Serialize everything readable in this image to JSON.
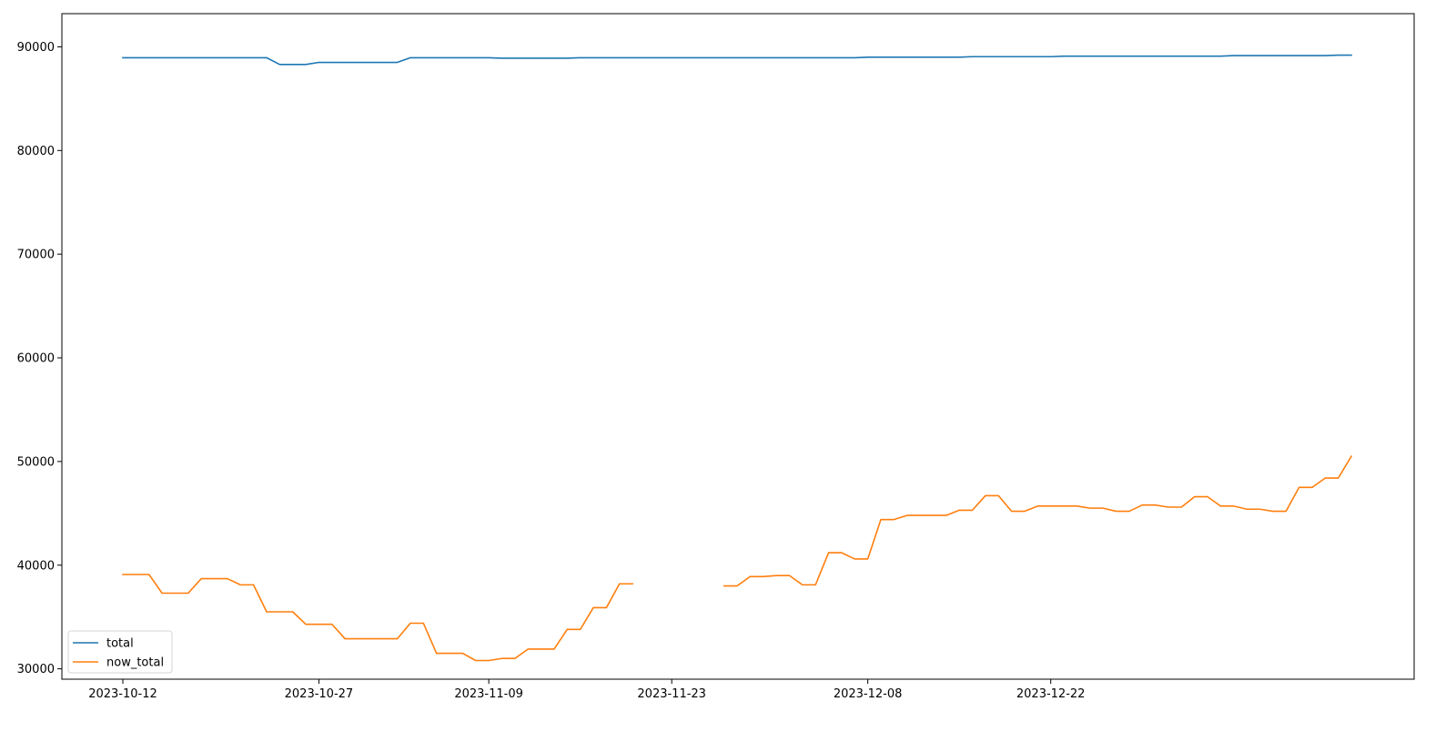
{
  "chart_data": {
    "type": "line",
    "title": "",
    "xlabel": "",
    "ylabel": "",
    "x_start": "2023-10-12",
    "dates": [
      "2023-10-12",
      "2023-10-13",
      "2023-10-14",
      "2023-10-15",
      "2023-10-16",
      "2023-10-17",
      "2023-10-18",
      "2023-10-19",
      "2023-10-20",
      "2023-10-21",
      "2023-10-22",
      "2023-10-23",
      "2023-10-24",
      "2023-10-25",
      "2023-10-26",
      "2023-10-27",
      "2023-10-28",
      "2023-10-29",
      "2023-10-30",
      "2023-10-31",
      "2023-11-01",
      "2023-11-02",
      "2023-11-03",
      "2023-11-04",
      "2023-11-05",
      "2023-11-06",
      "2023-11-07",
      "2023-11-08",
      "2023-11-09",
      "2023-11-10",
      "2023-11-11",
      "2023-11-12",
      "2023-11-13",
      "2023-11-14",
      "2023-11-15",
      "2023-11-16",
      "2023-11-17",
      "2023-11-18",
      "2023-11-19",
      "2023-11-20",
      "2023-11-21",
      "2023-11-22",
      "2023-11-23",
      "2023-11-24",
      "2023-11-25",
      "2023-11-26",
      "2023-11-27",
      "2023-11-28",
      "2023-11-29",
      "2023-11-30",
      "2023-12-01",
      "2023-12-02",
      "2023-12-03",
      "2023-12-04",
      "2023-12-05",
      "2023-12-06",
      "2023-12-07",
      "2023-12-08",
      "2023-12-09",
      "2023-12-10",
      "2023-12-11",
      "2023-12-12",
      "2023-12-13",
      "2023-12-14",
      "2023-12-15",
      "2023-12-16",
      "2023-12-17",
      "2023-12-18",
      "2023-12-19",
      "2023-12-20",
      "2023-12-21",
      "2023-12-22",
      "2023-12-23",
      "2023-12-24",
      "2023-12-25",
      "2023-12-26",
      "2023-12-27",
      "2023-12-28",
      "2023-12-29",
      "2023-12-30",
      "2023-12-31",
      "2024-01-01",
      "2024-01-02",
      "2024-01-03",
      "2024-01-04",
      "2024-01-05",
      "2024-01-06",
      "2024-01-07",
      "2024-01-08",
      "2024-01-09",
      "2024-01-10",
      "2024-01-11",
      "2024-01-12",
      "2024-01-13",
      "2024-01-14"
    ],
    "x_ticks": [
      {
        "label": "2023-10-12",
        "value": "2023-10-12"
      },
      {
        "label": "2023-10-27",
        "value": "2023-10-27"
      },
      {
        "label": "2023-11-09",
        "value": "2023-11-09"
      },
      {
        "label": "2023-11-23",
        "value": "2023-11-23"
      },
      {
        "label": "2023-12-08",
        "value": "2023-12-08"
      },
      {
        "label": "2023-12-22",
        "value": "2023-12-22"
      }
    ],
    "y_ticks": [
      30000,
      40000,
      50000,
      60000,
      70000,
      80000,
      90000
    ],
    "ylim": [
      29000,
      93200
    ],
    "legend": {
      "placement": "lower-left",
      "entries": [
        "total",
        "now_total"
      ]
    },
    "series": [
      {
        "name": "total",
        "color": "#1f77b4",
        "values": [
          88950,
          88950,
          88950,
          88950,
          88950,
          88950,
          88950,
          88950,
          88950,
          88950,
          88950,
          88950,
          88300,
          88300,
          88300,
          88500,
          88500,
          88500,
          88500,
          88500,
          88500,
          88500,
          88950,
          88950,
          88950,
          88950,
          88950,
          88950,
          88950,
          88900,
          88900,
          88900,
          88900,
          88900,
          88900,
          88950,
          88950,
          88950,
          88950,
          88950,
          88950,
          88950,
          88950,
          88950,
          88950,
          88950,
          88950,
          88950,
          88950,
          88950,
          88950,
          88950,
          88950,
          88950,
          88950,
          88950,
          88950,
          89000,
          89000,
          89000,
          89000,
          89000,
          89000,
          89000,
          89000,
          89050,
          89050,
          89050,
          89050,
          89050,
          89050,
          89050,
          89100,
          89100,
          89100,
          89100,
          89100,
          89100,
          89100,
          89100,
          89100,
          89100,
          89100,
          89100,
          89100,
          89150,
          89150,
          89150,
          89150,
          89150,
          89150,
          89150,
          89150,
          89200,
          89200
        ]
      },
      {
        "name": "now_total",
        "color": "#ff7f0e",
        "values": [
          39100,
          39100,
          39100,
          37300,
          37300,
          37300,
          38700,
          38700,
          38700,
          38100,
          38100,
          35500,
          35500,
          35500,
          34300,
          34300,
          34300,
          32900,
          32900,
          32900,
          32900,
          32900,
          34400,
          34400,
          31500,
          31500,
          31500,
          30800,
          30800,
          31000,
          31000,
          31900,
          31900,
          31900,
          33800,
          33800,
          35900,
          35900,
          38200,
          38200,
          null,
          null,
          null,
          null,
          null,
          null,
          38000,
          38000,
          38900,
          38900,
          39000,
          39000,
          38100,
          38100,
          41200,
          41200,
          40600,
          40600,
          44400,
          44400,
          44800,
          44800,
          44800,
          44800,
          45300,
          45300,
          46700,
          46700,
          45200,
          45200,
          45700,
          45700,
          45700,
          45700,
          45500,
          45500,
          45200,
          45200,
          45800,
          45800,
          45600,
          45600,
          46600,
          46600,
          45700,
          45700,
          45400,
          45400,
          45200,
          45200,
          47500,
          47500,
          48400,
          48400,
          50500
        ]
      }
    ]
  }
}
